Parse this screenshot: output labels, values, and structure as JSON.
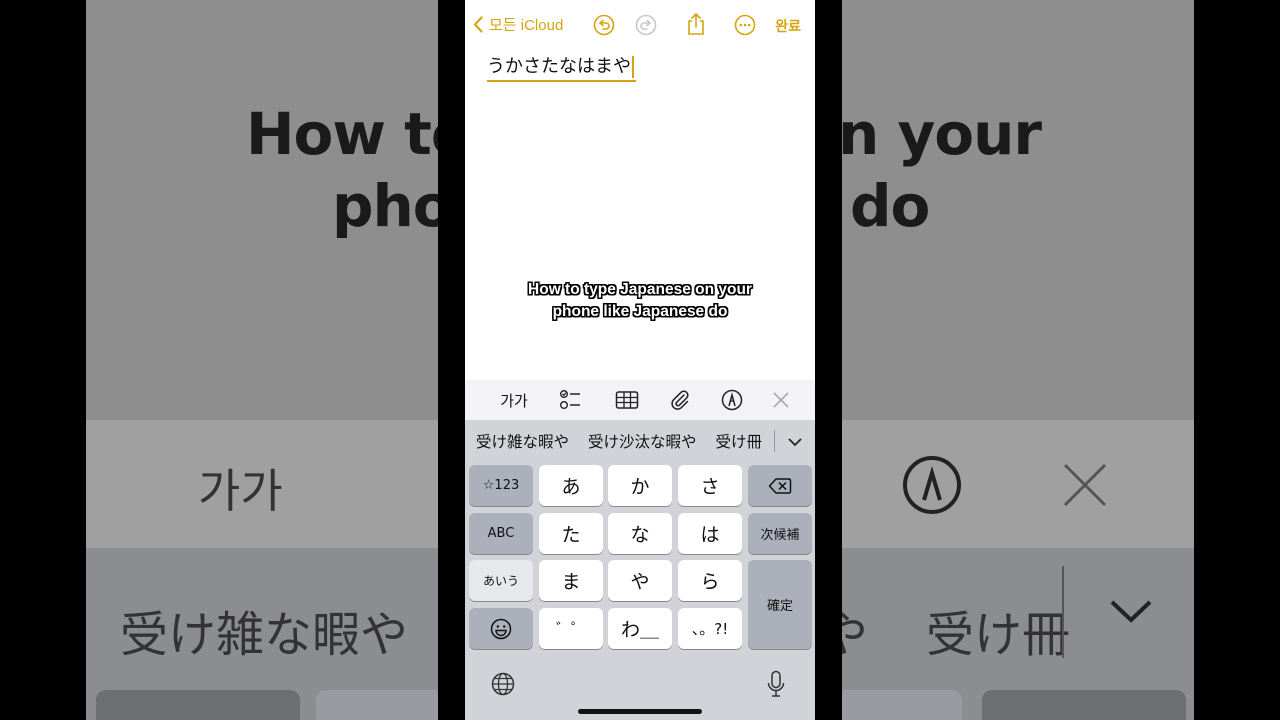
{
  "app": {
    "back_label": "모든 iCloud",
    "done_label": "완료",
    "icons": [
      "chevron-left-icon",
      "undo-icon",
      "redo-icon",
      "share-icon",
      "more-icon"
    ]
  },
  "note": {
    "text": "うかさたなはまや"
  },
  "caption": {
    "line1": "How to type Japanese on your",
    "line2": "phone like Japanese do"
  },
  "background": {
    "title_left_1": "How to",
    "title_left_2": "phon",
    "title_right_1": "n your",
    "title_right_2": "do",
    "format_label": "가가",
    "candidates_left": "受け雑な暇や",
    "cand_right_1": "や",
    "cand_right_2": "受け冊"
  },
  "toolbar": {
    "format_label": "가가",
    "icons": [
      "checklist-icon",
      "table-icon",
      "attachment-icon",
      "markup-pen-icon",
      "close-icon"
    ]
  },
  "keyboard": {
    "candidates": [
      "受け雑な暇や",
      "受け沙汰な暇や",
      "受け冊"
    ],
    "keys": {
      "k123": "☆123",
      "abc": "ABC",
      "aiu": "あいう",
      "a": "あ",
      "ka": "か",
      "sa": "さ",
      "ta": "た",
      "na": "な",
      "ha": "は",
      "ma": "ま",
      "ya": "や",
      "ra": "ら",
      "dakuten": "゛゜",
      "wa": "わ＿",
      "punct": "、。?!",
      "next_candidate": "次候補",
      "confirm": "確定"
    }
  }
}
